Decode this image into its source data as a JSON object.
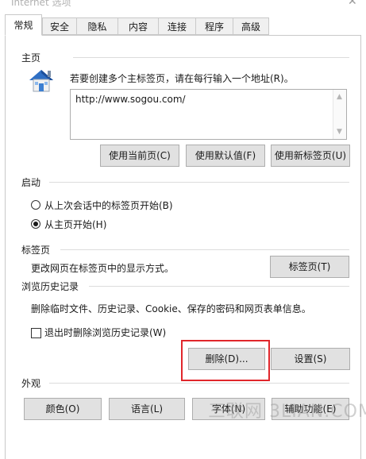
{
  "window": {
    "title": "Internet 选项",
    "close_glyph": "✕"
  },
  "tabs": [
    {
      "label": "常规",
      "active": true
    },
    {
      "label": "安全"
    },
    {
      "label": "隐私"
    },
    {
      "label": "内容"
    },
    {
      "label": "连接"
    },
    {
      "label": "程序"
    },
    {
      "label": "高级"
    }
  ],
  "homepage": {
    "section_title": "主页",
    "icon": "home-icon",
    "description": "若要创建多个主标签页，请在每行输入一个地址(R)。",
    "url": "http://www.sogou.com/",
    "buttons": {
      "use_current": "使用当前页(C)",
      "use_default": "使用默认值(F)",
      "use_new_tab": "使用新标签页(U)"
    }
  },
  "startup": {
    "section_title": "启动",
    "options": [
      {
        "label": "从上次会话中的标签页开始(B)",
        "selected": false
      },
      {
        "label": "从主页开始(H)",
        "selected": true
      }
    ]
  },
  "tabs_section": {
    "section_title": "标签页",
    "description": "更改网页在标签页中的显示方式。",
    "button": "标签页(T)"
  },
  "history": {
    "section_title": "浏览历史记录",
    "description": "删除临时文件、历史记录、Cookie、保存的密码和网页表单信息。",
    "checkbox_label": "退出时删除浏览历史记录(W)",
    "checkbox_checked": false,
    "delete_button": "删除(D)...",
    "settings_button": "设置(S)"
  },
  "appearance": {
    "section_title": "外观",
    "buttons": {
      "colors": "颜色(O)",
      "languages": "语言(L)",
      "fonts": "字体(N)",
      "accessibility": "辅助功能(E)"
    }
  },
  "watermark": "三联网 3LIAN.COM",
  "colors": {
    "highlight": "#e0262b",
    "button_bg": "#e1e1e1",
    "border": "#adadad"
  }
}
